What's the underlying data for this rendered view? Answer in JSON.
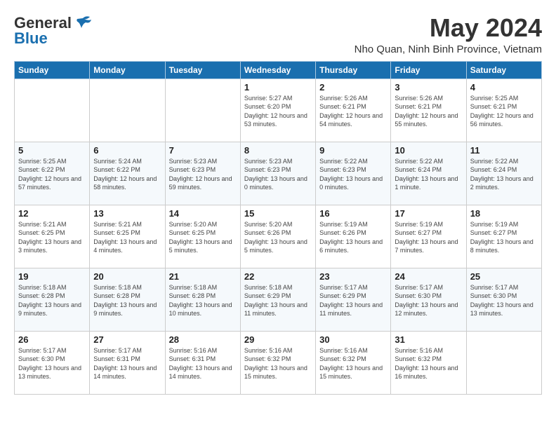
{
  "header": {
    "logo_line1": "General",
    "logo_line2": "Blue",
    "title": "May 2024",
    "subtitle": "Nho Quan, Ninh Binh Province, Vietnam"
  },
  "weekdays": [
    "Sunday",
    "Monday",
    "Tuesday",
    "Wednesday",
    "Thursday",
    "Friday",
    "Saturday"
  ],
  "weeks": [
    [
      {
        "day": "",
        "info": ""
      },
      {
        "day": "",
        "info": ""
      },
      {
        "day": "",
        "info": ""
      },
      {
        "day": "1",
        "info": "Sunrise: 5:27 AM\nSunset: 6:20 PM\nDaylight: 12 hours\nand 53 minutes."
      },
      {
        "day": "2",
        "info": "Sunrise: 5:26 AM\nSunset: 6:21 PM\nDaylight: 12 hours\nand 54 minutes."
      },
      {
        "day": "3",
        "info": "Sunrise: 5:26 AM\nSunset: 6:21 PM\nDaylight: 12 hours\nand 55 minutes."
      },
      {
        "day": "4",
        "info": "Sunrise: 5:25 AM\nSunset: 6:21 PM\nDaylight: 12 hours\nand 56 minutes."
      }
    ],
    [
      {
        "day": "5",
        "info": "Sunrise: 5:25 AM\nSunset: 6:22 PM\nDaylight: 12 hours\nand 57 minutes."
      },
      {
        "day": "6",
        "info": "Sunrise: 5:24 AM\nSunset: 6:22 PM\nDaylight: 12 hours\nand 58 minutes."
      },
      {
        "day": "7",
        "info": "Sunrise: 5:23 AM\nSunset: 6:23 PM\nDaylight: 12 hours\nand 59 minutes."
      },
      {
        "day": "8",
        "info": "Sunrise: 5:23 AM\nSunset: 6:23 PM\nDaylight: 13 hours\nand 0 minutes."
      },
      {
        "day": "9",
        "info": "Sunrise: 5:22 AM\nSunset: 6:23 PM\nDaylight: 13 hours\nand 0 minutes."
      },
      {
        "day": "10",
        "info": "Sunrise: 5:22 AM\nSunset: 6:24 PM\nDaylight: 13 hours\nand 1 minute."
      },
      {
        "day": "11",
        "info": "Sunrise: 5:22 AM\nSunset: 6:24 PM\nDaylight: 13 hours\nand 2 minutes."
      }
    ],
    [
      {
        "day": "12",
        "info": "Sunrise: 5:21 AM\nSunset: 6:25 PM\nDaylight: 13 hours\nand 3 minutes."
      },
      {
        "day": "13",
        "info": "Sunrise: 5:21 AM\nSunset: 6:25 PM\nDaylight: 13 hours\nand 4 minutes."
      },
      {
        "day": "14",
        "info": "Sunrise: 5:20 AM\nSunset: 6:25 PM\nDaylight: 13 hours\nand 5 minutes."
      },
      {
        "day": "15",
        "info": "Sunrise: 5:20 AM\nSunset: 6:26 PM\nDaylight: 13 hours\nand 5 minutes."
      },
      {
        "day": "16",
        "info": "Sunrise: 5:19 AM\nSunset: 6:26 PM\nDaylight: 13 hours\nand 6 minutes."
      },
      {
        "day": "17",
        "info": "Sunrise: 5:19 AM\nSunset: 6:27 PM\nDaylight: 13 hours\nand 7 minutes."
      },
      {
        "day": "18",
        "info": "Sunrise: 5:19 AM\nSunset: 6:27 PM\nDaylight: 13 hours\nand 8 minutes."
      }
    ],
    [
      {
        "day": "19",
        "info": "Sunrise: 5:18 AM\nSunset: 6:28 PM\nDaylight: 13 hours\nand 9 minutes."
      },
      {
        "day": "20",
        "info": "Sunrise: 5:18 AM\nSunset: 6:28 PM\nDaylight: 13 hours\nand 9 minutes."
      },
      {
        "day": "21",
        "info": "Sunrise: 5:18 AM\nSunset: 6:28 PM\nDaylight: 13 hours\nand 10 minutes."
      },
      {
        "day": "22",
        "info": "Sunrise: 5:18 AM\nSunset: 6:29 PM\nDaylight: 13 hours\nand 11 minutes."
      },
      {
        "day": "23",
        "info": "Sunrise: 5:17 AM\nSunset: 6:29 PM\nDaylight: 13 hours\nand 11 minutes."
      },
      {
        "day": "24",
        "info": "Sunrise: 5:17 AM\nSunset: 6:30 PM\nDaylight: 13 hours\nand 12 minutes."
      },
      {
        "day": "25",
        "info": "Sunrise: 5:17 AM\nSunset: 6:30 PM\nDaylight: 13 hours\nand 13 minutes."
      }
    ],
    [
      {
        "day": "26",
        "info": "Sunrise: 5:17 AM\nSunset: 6:30 PM\nDaylight: 13 hours\nand 13 minutes."
      },
      {
        "day": "27",
        "info": "Sunrise: 5:17 AM\nSunset: 6:31 PM\nDaylight: 13 hours\nand 14 minutes."
      },
      {
        "day": "28",
        "info": "Sunrise: 5:16 AM\nSunset: 6:31 PM\nDaylight: 13 hours\nand 14 minutes."
      },
      {
        "day": "29",
        "info": "Sunrise: 5:16 AM\nSunset: 6:32 PM\nDaylight: 13 hours\nand 15 minutes."
      },
      {
        "day": "30",
        "info": "Sunrise: 5:16 AM\nSunset: 6:32 PM\nDaylight: 13 hours\nand 15 minutes."
      },
      {
        "day": "31",
        "info": "Sunrise: 5:16 AM\nSunset: 6:32 PM\nDaylight: 13 hours\nand 16 minutes."
      },
      {
        "day": "",
        "info": ""
      }
    ]
  ]
}
